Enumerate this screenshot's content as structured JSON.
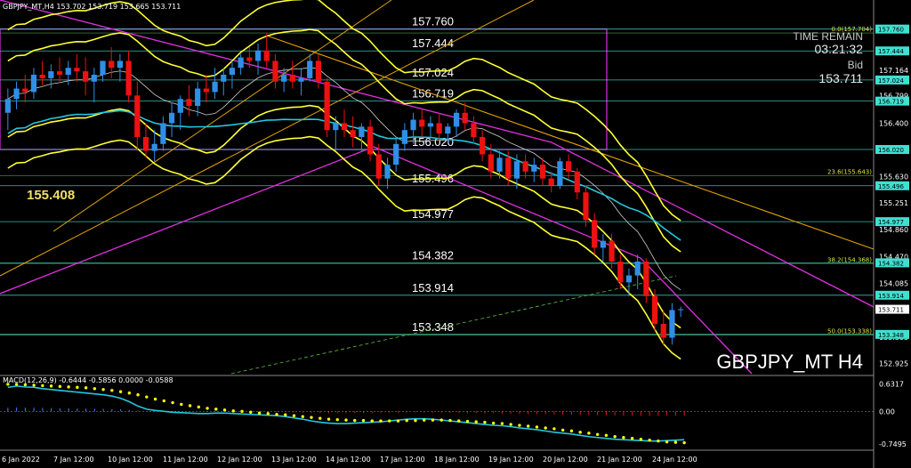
{
  "header": {
    "symbol_line": "GBPJPY_MT,H4 153.702 153.719 153.665 153.711",
    "macd_label": "MACD(12,26,9) -0.6444 -0.5856 0.0000 -0.0588"
  },
  "info": {
    "time_remain_label": "TIME REMAIN",
    "time_remain_value": "03:21:32",
    "bid_label": "Bid",
    "bid_value": "153.711",
    "watermark": "GBPJPY_MT H4"
  },
  "annotation_price": "155.408",
  "colors": {
    "background": "#000000",
    "bull": "#2f8fe8",
    "bear": "#ee1111",
    "envelope": "#ffff33",
    "ma_cyan": "#22c8e0",
    "trend_magenta": "#e030e0",
    "trend_orange": "#e0a000",
    "level_line": "#40e0d0",
    "macd_signal": "#ffff00"
  },
  "chart_data": {
    "type": "candlestick",
    "symbol": "GBPJPY_MT",
    "timeframe": "H4",
    "ylim": [
      152.78,
      158.0
    ],
    "y_ticks": [
      "157.760",
      "157.444",
      "157.164",
      "157.024",
      "156.799",
      "156.719",
      "156.400",
      "156.020",
      "155.630",
      "155.496",
      "155.251",
      "154.977",
      "154.860",
      "154.470",
      "154.382",
      "154.085",
      "153.914",
      "153.711",
      "153.348",
      "153.305",
      "152.925"
    ],
    "x_ticks": [
      "6 Jan 2022",
      "7 Jan 12:00",
      "10 Jan 12:00",
      "11 Jan 12:00",
      "12 Jan 12:00",
      "13 Jan 12:00",
      "14 Jan 12:00",
      "17 Jan 12:00",
      "18 Jan 12:00",
      "19 Jan 12:00",
      "20 Jan 12:00",
      "21 Jan 12:00",
      "24 Jan 12:00"
    ],
    "levels": [
      {
        "value": 157.76,
        "label": "157.760",
        "tag": "157.760"
      },
      {
        "value": 157.444,
        "label": "157.444",
        "tag": "157.444"
      },
      {
        "value": 157.024,
        "label": "157.024",
        "tag": "157.024"
      },
      {
        "value": 156.719,
        "label": "156.719",
        "tag": "156.719"
      },
      {
        "value": 156.02,
        "label": "156.020",
        "tag": "156.020"
      },
      {
        "value": 155.496,
        "label": "155.496",
        "tag": "155.496"
      },
      {
        "value": 154.977,
        "label": "154.977",
        "tag": "154.977"
      },
      {
        "value": 154.382,
        "label": "154.382",
        "tag": "154.382"
      },
      {
        "value": 153.914,
        "label": "153.914",
        "tag": "153.914"
      },
      {
        "value": 153.348,
        "label": "153.348",
        "tag": "153.348"
      }
    ],
    "fib_levels": [
      {
        "label": "0.0(157.704)",
        "value": 157.704
      },
      {
        "label": "23.6(155.643)",
        "value": 155.643
      },
      {
        "label": "38.2(154.368)",
        "value": 154.368
      },
      {
        "label": "50.0(153.338)",
        "value": 153.338
      }
    ],
    "current_price": 153.711,
    "macd_ticks": [
      "0.6317",
      "0.00",
      "-0.7495"
    ],
    "macd_range": [
      -0.85,
      0.7
    ],
    "candles": [
      {
        "o": 156.55,
        "h": 156.9,
        "l": 156.3,
        "c": 156.75
      },
      {
        "o": 156.75,
        "h": 157.0,
        "l": 156.6,
        "c": 156.9
      },
      {
        "o": 156.9,
        "h": 157.1,
        "l": 156.7,
        "c": 156.85
      },
      {
        "o": 156.85,
        "h": 157.2,
        "l": 156.75,
        "c": 157.1
      },
      {
        "o": 157.1,
        "h": 157.3,
        "l": 156.95,
        "c": 157.05
      },
      {
        "o": 157.05,
        "h": 157.25,
        "l": 156.9,
        "c": 157.15
      },
      {
        "o": 157.15,
        "h": 157.35,
        "l": 157.0,
        "c": 157.1
      },
      {
        "o": 157.1,
        "h": 157.3,
        "l": 156.95,
        "c": 157.2
      },
      {
        "o": 157.2,
        "h": 157.4,
        "l": 157.0,
        "c": 157.15
      },
      {
        "o": 157.15,
        "h": 157.35,
        "l": 156.8,
        "c": 157.0
      },
      {
        "o": 157.0,
        "h": 157.2,
        "l": 156.7,
        "c": 157.1
      },
      {
        "o": 157.1,
        "h": 157.3,
        "l": 157.0,
        "c": 157.3
      },
      {
        "o": 157.3,
        "h": 157.5,
        "l": 157.05,
        "c": 157.2
      },
      {
        "o": 157.2,
        "h": 157.4,
        "l": 157.0,
        "c": 157.3
      },
      {
        "o": 157.3,
        "h": 157.45,
        "l": 156.7,
        "c": 156.8
      },
      {
        "o": 156.8,
        "h": 157.0,
        "l": 156.0,
        "c": 156.2
      },
      {
        "o": 156.2,
        "h": 156.4,
        "l": 155.9,
        "c": 156.0
      },
      {
        "o": 156.0,
        "h": 156.3,
        "l": 155.85,
        "c": 156.1
      },
      {
        "o": 156.1,
        "h": 156.5,
        "l": 156.0,
        "c": 156.4
      },
      {
        "o": 156.4,
        "h": 156.7,
        "l": 156.2,
        "c": 156.55
      },
      {
        "o": 156.55,
        "h": 156.8,
        "l": 156.3,
        "c": 156.75
      },
      {
        "o": 156.75,
        "h": 156.95,
        "l": 156.5,
        "c": 156.65
      },
      {
        "o": 156.65,
        "h": 157.0,
        "l": 156.5,
        "c": 156.9
      },
      {
        "o": 156.9,
        "h": 157.1,
        "l": 156.7,
        "c": 156.85
      },
      {
        "o": 156.85,
        "h": 157.2,
        "l": 156.75,
        "c": 157.0
      },
      {
        "o": 157.0,
        "h": 157.2,
        "l": 156.8,
        "c": 157.1
      },
      {
        "o": 157.1,
        "h": 157.3,
        "l": 156.9,
        "c": 157.2
      },
      {
        "o": 157.2,
        "h": 157.4,
        "l": 157.1,
        "c": 157.35
      },
      {
        "o": 157.35,
        "h": 157.5,
        "l": 157.2,
        "c": 157.3
      },
      {
        "o": 157.3,
        "h": 157.55,
        "l": 157.1,
        "c": 157.45
      },
      {
        "o": 157.45,
        "h": 157.7,
        "l": 157.2,
        "c": 157.3
      },
      {
        "o": 157.3,
        "h": 157.4,
        "l": 156.9,
        "c": 157.0
      },
      {
        "o": 157.0,
        "h": 157.2,
        "l": 156.85,
        "c": 157.1
      },
      {
        "o": 157.1,
        "h": 157.3,
        "l": 156.9,
        "c": 157.0
      },
      {
        "o": 157.0,
        "h": 157.2,
        "l": 156.8,
        "c": 157.05
      },
      {
        "o": 157.05,
        "h": 157.4,
        "l": 157.0,
        "c": 157.3
      },
      {
        "o": 157.3,
        "h": 157.4,
        "l": 156.9,
        "c": 157.0
      },
      {
        "o": 157.0,
        "h": 157.05,
        "l": 156.2,
        "c": 156.3
      },
      {
        "o": 156.3,
        "h": 156.5,
        "l": 156.0,
        "c": 156.4
      },
      {
        "o": 156.4,
        "h": 156.6,
        "l": 156.2,
        "c": 156.3
      },
      {
        "o": 156.3,
        "h": 156.5,
        "l": 156.05,
        "c": 156.2
      },
      {
        "o": 156.2,
        "h": 156.4,
        "l": 156.0,
        "c": 156.35
      },
      {
        "o": 156.35,
        "h": 156.45,
        "l": 155.85,
        "c": 155.95
      },
      {
        "o": 155.95,
        "h": 156.1,
        "l": 155.5,
        "c": 155.6
      },
      {
        "o": 155.6,
        "h": 155.9,
        "l": 155.45,
        "c": 155.8
      },
      {
        "o": 155.8,
        "h": 156.2,
        "l": 155.7,
        "c": 156.1
      },
      {
        "o": 156.1,
        "h": 156.4,
        "l": 156.0,
        "c": 156.3
      },
      {
        "o": 156.3,
        "h": 156.55,
        "l": 156.1,
        "c": 156.45
      },
      {
        "o": 156.45,
        "h": 156.6,
        "l": 156.2,
        "c": 156.35
      },
      {
        "o": 156.35,
        "h": 156.5,
        "l": 156.2,
        "c": 156.4
      },
      {
        "o": 156.4,
        "h": 156.55,
        "l": 156.15,
        "c": 156.25
      },
      {
        "o": 156.25,
        "h": 156.4,
        "l": 156.1,
        "c": 156.35
      },
      {
        "o": 156.35,
        "h": 156.6,
        "l": 156.2,
        "c": 156.55
      },
      {
        "o": 156.55,
        "h": 156.7,
        "l": 156.3,
        "c": 156.4
      },
      {
        "o": 156.4,
        "h": 156.5,
        "l": 156.1,
        "c": 156.2
      },
      {
        "o": 156.2,
        "h": 156.3,
        "l": 155.85,
        "c": 155.95
      },
      {
        "o": 155.95,
        "h": 156.1,
        "l": 155.6,
        "c": 155.7
      },
      {
        "o": 155.7,
        "h": 156.0,
        "l": 155.6,
        "c": 155.9
      },
      {
        "o": 155.9,
        "h": 156.0,
        "l": 155.5,
        "c": 155.6
      },
      {
        "o": 155.6,
        "h": 155.95,
        "l": 155.45,
        "c": 155.85
      },
      {
        "o": 155.85,
        "h": 155.95,
        "l": 155.6,
        "c": 155.7
      },
      {
        "o": 155.7,
        "h": 155.9,
        "l": 155.55,
        "c": 155.8
      },
      {
        "o": 155.8,
        "h": 155.9,
        "l": 155.5,
        "c": 155.6
      },
      {
        "o": 155.6,
        "h": 155.7,
        "l": 155.4,
        "c": 155.5
      },
      {
        "o": 155.5,
        "h": 155.9,
        "l": 155.45,
        "c": 155.85
      },
      {
        "o": 155.85,
        "h": 155.95,
        "l": 155.6,
        "c": 155.7
      },
      {
        "o": 155.7,
        "h": 155.75,
        "l": 155.3,
        "c": 155.4
      },
      {
        "o": 155.4,
        "h": 155.5,
        "l": 154.9,
        "c": 155.0
      },
      {
        "o": 155.0,
        "h": 155.1,
        "l": 154.5,
        "c": 154.6
      },
      {
        "o": 154.6,
        "h": 154.8,
        "l": 154.4,
        "c": 154.7
      },
      {
        "o": 154.7,
        "h": 154.8,
        "l": 154.3,
        "c": 154.4
      },
      {
        "o": 154.4,
        "h": 154.5,
        "l": 154.0,
        "c": 154.1
      },
      {
        "o": 154.1,
        "h": 154.3,
        "l": 153.9,
        "c": 154.2
      },
      {
        "o": 154.2,
        "h": 154.5,
        "l": 154.0,
        "c": 154.4
      },
      {
        "o": 154.4,
        "h": 154.45,
        "l": 153.8,
        "c": 153.9
      },
      {
        "o": 153.9,
        "h": 154.0,
        "l": 153.4,
        "c": 153.5
      },
      {
        "o": 153.5,
        "h": 153.7,
        "l": 153.2,
        "c": 153.3
      },
      {
        "o": 153.3,
        "h": 153.8,
        "l": 153.2,
        "c": 153.7
      },
      {
        "o": 153.7,
        "h": 153.75,
        "l": 153.6,
        "c": 153.711
      }
    ],
    "macd_hist": [
      0.55,
      0.58,
      0.56,
      0.55,
      0.52,
      0.5,
      0.48,
      0.46,
      0.44,
      0.42,
      0.4,
      0.38,
      0.35,
      0.3,
      0.22,
      0.12,
      0.05,
      0.02,
      0.0,
      -0.02,
      -0.03,
      -0.04,
      -0.05,
      -0.05,
      -0.04,
      -0.04,
      -0.05,
      -0.06,
      -0.07,
      -0.08,
      -0.09,
      -0.1,
      -0.12,
      -0.15,
      -0.18,
      -0.22,
      -0.25,
      -0.27,
      -0.28,
      -0.28,
      -0.27,
      -0.26,
      -0.25,
      -0.24,
      -0.22,
      -0.2,
      -0.18,
      -0.17,
      -0.17,
      -0.18,
      -0.2,
      -0.22,
      -0.24,
      -0.26,
      -0.28,
      -0.3,
      -0.32,
      -0.33,
      -0.35,
      -0.38,
      -0.4,
      -0.42,
      -0.45,
      -0.48,
      -0.5,
      -0.52,
      -0.55,
      -0.58,
      -0.6,
      -0.62,
      -0.64,
      -0.65,
      -0.66,
      -0.67,
      -0.68,
      -0.68,
      -0.67,
      -0.66,
      -0.65
    ],
    "macd_signal": [
      0.62,
      0.62,
      0.61,
      0.6,
      0.59,
      0.58,
      0.57,
      0.56,
      0.55,
      0.54,
      0.52,
      0.5,
      0.48,
      0.45,
      0.42,
      0.38,
      0.33,
      0.28,
      0.24,
      0.2,
      0.16,
      0.13,
      0.1,
      0.07,
      0.05,
      0.03,
      0.01,
      0.0,
      -0.02,
      -0.04,
      -0.05,
      -0.07,
      -0.08,
      -0.1,
      -0.12,
      -0.14,
      -0.16,
      -0.18,
      -0.19,
      -0.2,
      -0.21,
      -0.21,
      -0.22,
      -0.22,
      -0.22,
      -0.22,
      -0.21,
      -0.21,
      -0.2,
      -0.2,
      -0.2,
      -0.21,
      -0.22,
      -0.23,
      -0.24,
      -0.25,
      -0.27,
      -0.28,
      -0.3,
      -0.32,
      -0.34,
      -0.36,
      -0.38,
      -0.4,
      -0.43,
      -0.45,
      -0.48,
      -0.5,
      -0.53,
      -0.55,
      -0.58,
      -0.6,
      -0.62,
      -0.64,
      -0.66,
      -0.68,
      -0.7,
      -0.71,
      -0.72
    ]
  }
}
